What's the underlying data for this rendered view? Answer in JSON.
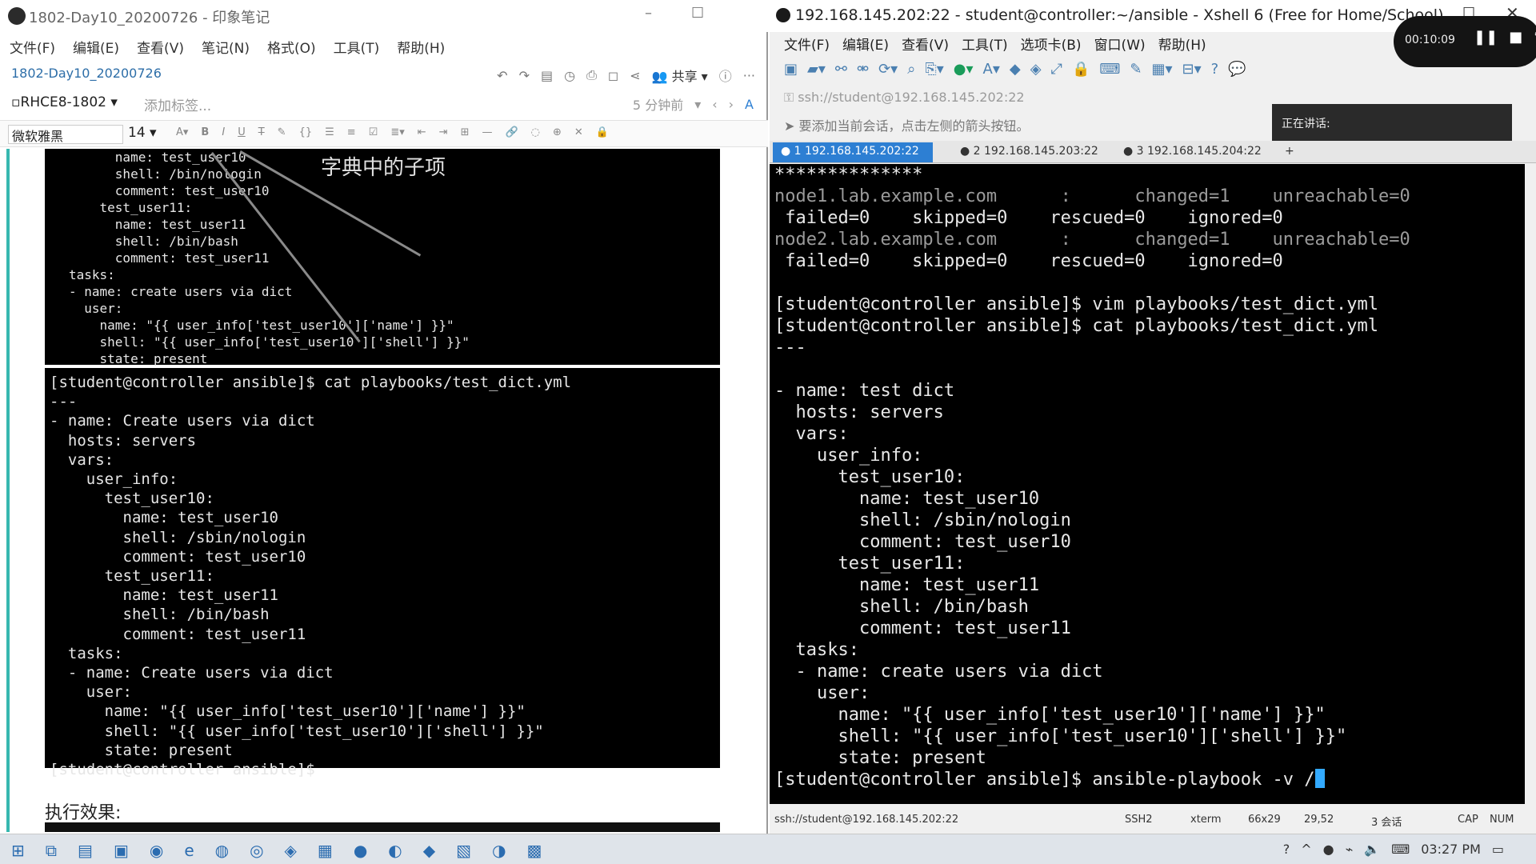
{
  "evernote": {
    "window_title": "1802-Day10_20200726 - 印象笔记",
    "menu": [
      "文件(F)",
      "编辑(E)",
      "查看(V)",
      "笔记(N)",
      "格式(O)",
      "工具(T)",
      "帮助(H)"
    ],
    "note_title": "1802-Day10_20200726",
    "share_label": "共享",
    "notebook": "RHCE8-1802",
    "add_tag": "添加标签...",
    "modified": "5 分钟前",
    "font_name": "微软雅黑",
    "font_size": "14",
    "annotation": "字典中的子项",
    "img1_lines": [
      "      name: test_user10",
      "      shell: /bin/nologin",
      "      comment: test_user10",
      "    test_user11:",
      "      name: test_user11",
      "      shell: /bin/bash",
      "      comment: test_user11",
      "tasks:",
      "- name: create users via dict",
      "  user:",
      "    name: \"{{ user_info['test_user10']['name'] }}\"",
      "    shell: \"{{ user_info['test_user10']['shell'] }}\"",
      "    state: present"
    ],
    "img2_lines": [
      "[student@controller ansible]$ cat playbooks/test_dict.yml",
      "---",
      "- name: Create users via dict",
      "  hosts: servers",
      "  vars:",
      "    user_info:",
      "      test_user10:",
      "        name: test_user10",
      "        shell: /sbin/nologin",
      "        comment: test_user10",
      "      test_user11:",
      "        name: test_user11",
      "        shell: /bin/bash",
      "        comment: test_user11",
      "  tasks:",
      "  - name: Create users via dict",
      "    user:",
      "      name: \"{{ user_info['test_user10']['name'] }}\"",
      "      shell: \"{{ user_info['test_user10']['shell'] }}\"",
      "      state: present",
      "[student@controller ansible]$"
    ],
    "exec_label": "执行效果:"
  },
  "xshell": {
    "window_title": "192.168.145.202:22 - student@controller:~/ansible - Xshell 6 (Free for Home/School)",
    "recording_time": "00:10:09",
    "menu": [
      "文件(F)",
      "编辑(E)",
      "查看(V)",
      "工具(T)",
      "选项卡(B)",
      "窗口(W)",
      "帮助(H)"
    ],
    "address": "ssh://student@192.168.145.202:22",
    "hint": "要添加当前会话，点击左侧的箭头按钮。",
    "speaking": "正在讲话:",
    "tabs": [
      "1 192.168.145.202:22",
      "2 192.168.145.203:22",
      "3 192.168.145.204:22"
    ],
    "terminal_lines": [
      "**************",
      "node1.lab.example.com      :      changed=1    unreachable=0",
      " failed=0    skipped=0    rescued=0    ignored=0",
      "node2.lab.example.com      :      changed=1    unreachable=0",
      " failed=0    skipped=0    rescued=0    ignored=0",
      "",
      "[student@controller ansible]$ vim playbooks/test_dict.yml",
      "[student@controller ansible]$ cat playbooks/test_dict.yml",
      "---",
      "",
      "- name: test dict",
      "  hosts: servers",
      "  vars:",
      "    user_info:",
      "      test_user10:",
      "        name: test_user10",
      "        shell: /sbin/nologin",
      "        comment: test_user10",
      "      test_user11:",
      "        name: test_user11",
      "        shell: /bin/bash",
      "        comment: test_user11",
      "  tasks:",
      "  - name: create users via dict",
      "    user:",
      "      name: \"{{ user_info['test_user10']['name'] }}\"",
      "      shell: \"{{ user_info['test_user10']['shell'] }}\"",
      "      state: present",
      "[student@controller ansible]$ ansible-playbook -v /"
    ],
    "status": {
      "address": "ssh://student@192.168.145.202:22",
      "protocol": "SSH2",
      "term": "xterm",
      "size": "66x29",
      "pos": "29,52",
      "sessions": "3 会话",
      "cap": "CAP",
      "num": "NUM"
    }
  },
  "taskbar": {
    "clock": "03:27 PM"
  },
  "colors": {
    "accent": "#2d7fd3",
    "evernote_border": "#37b8b0",
    "link": "#2d6ea8"
  }
}
